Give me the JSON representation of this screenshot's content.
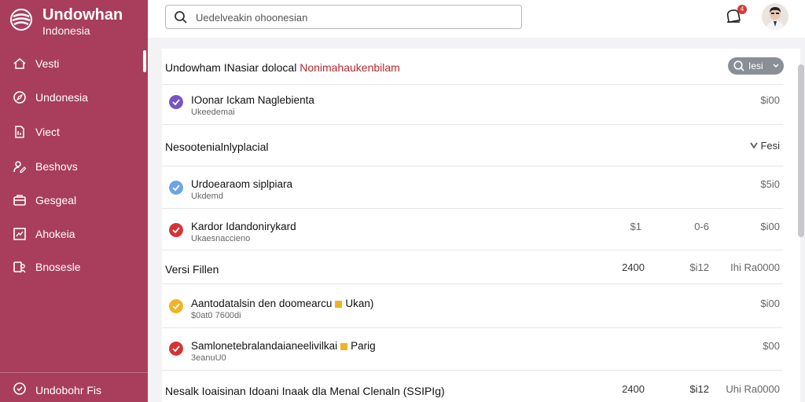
{
  "brand": {
    "name": "Undowhan",
    "subtitle": "Indonesia"
  },
  "sidebar": {
    "items": [
      {
        "label": "Vesti",
        "icon": "home-icon"
      },
      {
        "label": "Undonesia",
        "icon": "compass-icon"
      },
      {
        "label": "Viect",
        "icon": "document-icon"
      },
      {
        "label": "Beshovs",
        "icon": "user-edit-icon"
      },
      {
        "label": "Gesgeal",
        "icon": "briefcase-icon"
      },
      {
        "label": "Ahokeia",
        "icon": "chart-icon"
      },
      {
        "label": "Bnosesle",
        "icon": "people-icon"
      }
    ],
    "bottom_label": "Undobohr Fis"
  },
  "header": {
    "search_placeholder": "Uedelveakin ohoonesian",
    "notification_count": "4"
  },
  "colors": {
    "sidebar": "#a83e5c",
    "accent": "#b7282e",
    "pill": "#8a8f96"
  },
  "list": {
    "section1": {
      "title": "Undowham INasiar dolocal",
      "title_accent": "Nonimahaukenbilam",
      "filter_label": "Iesi"
    },
    "item1": {
      "title": "IOonar Ickam Naglebienta",
      "subtitle": "Ukeedemai",
      "amount": "$i00",
      "check_color": "#7654c8"
    },
    "section2": {
      "title": "Nesootenialnlyplacial",
      "action_label": "Fesi"
    },
    "item2": {
      "title": "Urdoearaom siplpiara",
      "subtitle": "Ukdemd",
      "amount": "$5i0",
      "check_color": "#6ea3e6"
    },
    "item3": {
      "title": "Kardor Idandonirykard",
      "subtitle": "Ukaesnaccieno",
      "col1": "$1",
      "col2": "0-6",
      "amount": "$i00",
      "check_color": "#d63236"
    },
    "section3": {
      "title": "Versi Fillen",
      "col1": "2400",
      "col2": "$i12",
      "col3": "Ihi Ra0000"
    },
    "item4": {
      "title": "Aantodatalsin den doomearcu",
      "tag_text": "Ukan)",
      "subtitle": "$0at0 7600di",
      "amount": "$i00",
      "check_color": "#f0b323"
    },
    "item5": {
      "title": "Samlonetebralandaianeelivilkai",
      "tag_text": "Parig",
      "subtitle": "3eanuU0",
      "amount": "$00",
      "check_color": "#d63236"
    },
    "section4": {
      "title": "Nesalk Ioaisinan Idoani Inaak dla Menal Clenaln (SSIPIg)",
      "col1": "2400",
      "col2": "$i12",
      "col3": "Uhi Ra0000"
    }
  }
}
